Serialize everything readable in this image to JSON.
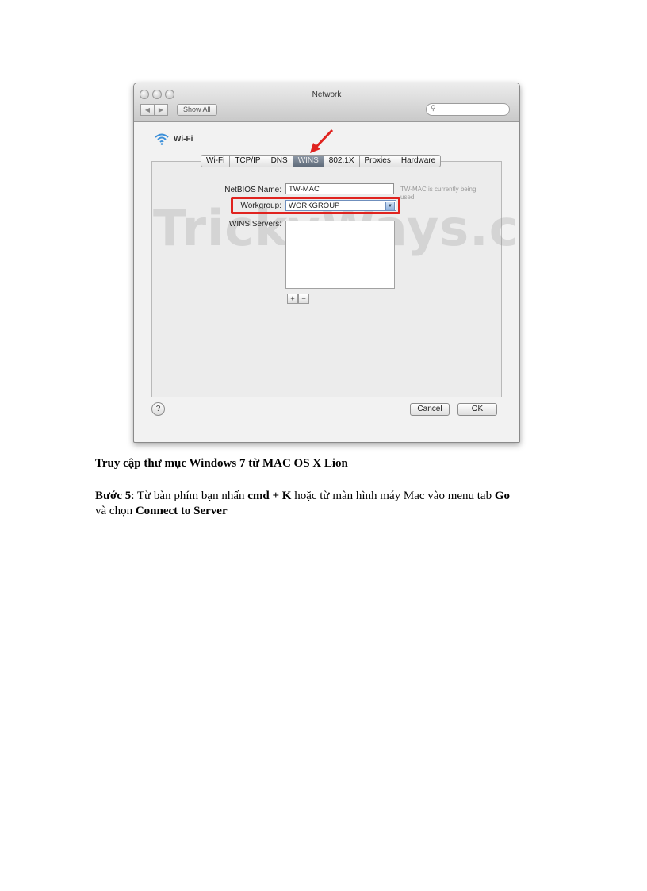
{
  "screenshot": {
    "window_title": "Network",
    "show_all_label": "Show All",
    "interface_label": "Wi-Fi",
    "tabs": [
      "Wi-Fi",
      "TCP/IP",
      "DNS",
      "WINS",
      "802.1X",
      "Proxies",
      "Hardware"
    ],
    "active_tab": "WINS",
    "netbios_label": "NetBIOS Name:",
    "netbios_value": "TW-MAC",
    "netbios_hint": "TW-MAC is currently being used.",
    "workgroup_label": "Workgroup:",
    "workgroup_value": "WORKGROUP",
    "wins_servers_label": "WINS Servers:",
    "add_label": "+",
    "remove_label": "−",
    "help_label": "?",
    "cancel_label": "Cancel",
    "ok_label": "OK",
    "watermark": "TrickyWays.com",
    "highlight_color": "#e0231f"
  },
  "caption": "Truy cập thư mục Windows 7 từ MAC OS X Lion",
  "step": {
    "step_label": "Bước 5",
    "text_1": ": Từ bàn phím bạn nhấn ",
    "shortcut": "cmd + K",
    "text_2": " hoặc từ màn hình máy Mac vào menu tab ",
    "menu": "Go",
    "text_3": " và chọn ",
    "command": "Connect to Server"
  }
}
